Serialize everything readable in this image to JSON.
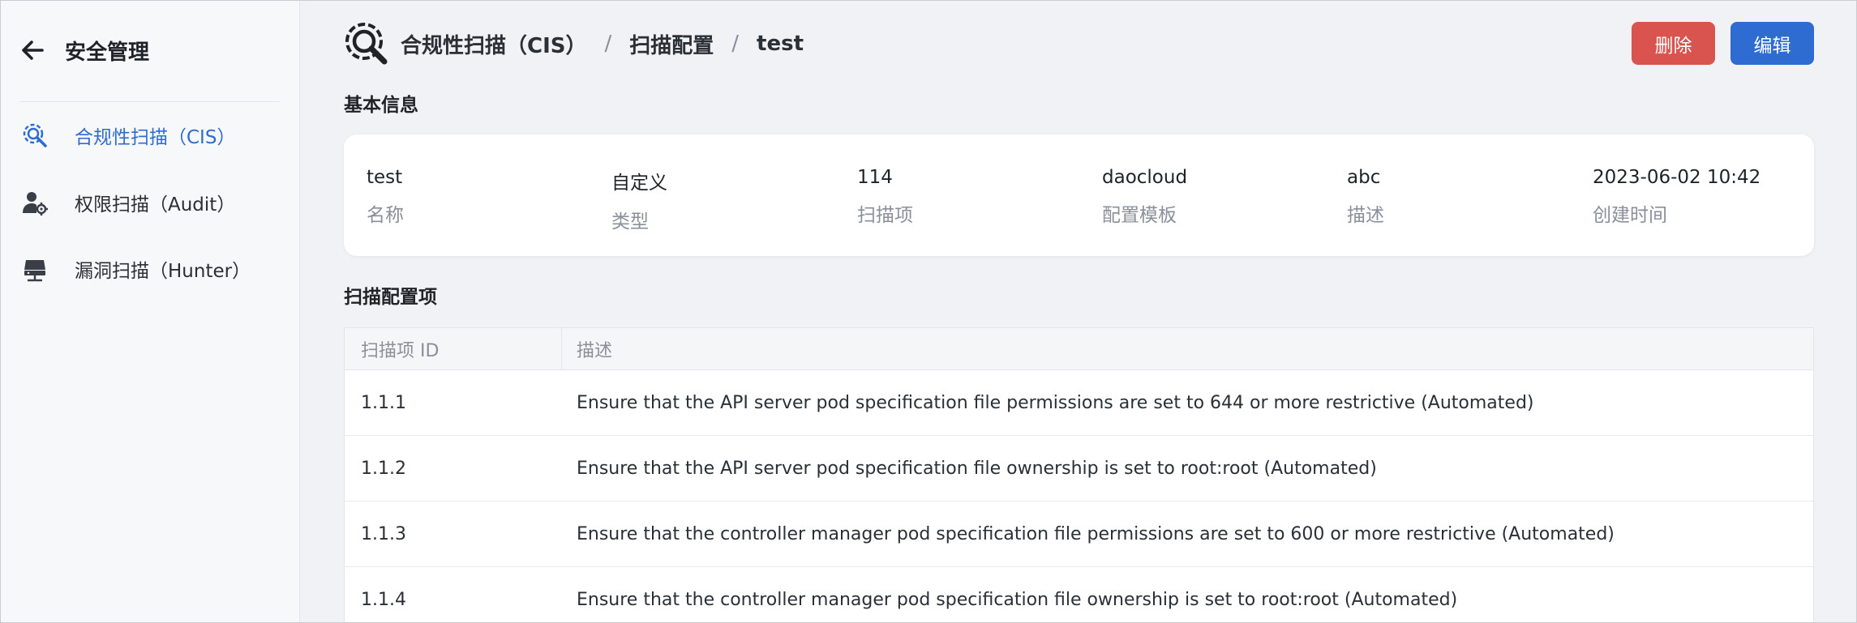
{
  "sidebar": {
    "title": "安全管理",
    "items": [
      {
        "label": "合规性扫描（CIS）",
        "icon": "compliance-scan-icon",
        "active": true
      },
      {
        "label": "权限扫描（Audit）",
        "icon": "permission-scan-icon",
        "active": false
      },
      {
        "label": "漏洞扫描（Hunter）",
        "icon": "vulnerability-scan-icon",
        "active": false
      }
    ]
  },
  "header": {
    "breadcrumb": [
      "合规性扫描（CIS）",
      "扫描配置",
      "test"
    ],
    "separator": "/",
    "delete_label": "删除",
    "edit_label": "编辑"
  },
  "basic_info": {
    "title": "基本信息",
    "fields": [
      {
        "value": "test",
        "label": "名称"
      },
      {
        "value": "自定义",
        "label": "类型"
      },
      {
        "value": "114",
        "label": "扫描项"
      },
      {
        "value": "daocloud",
        "label": "配置模板"
      },
      {
        "value": "abc",
        "label": "描述"
      },
      {
        "value": "2023-06-02 10:42",
        "label": "创建时间"
      }
    ]
  },
  "scan_items": {
    "title": "扫描配置项",
    "columns": [
      "扫描项 ID",
      "描述"
    ],
    "rows": [
      {
        "id": "1.1.1",
        "desc": "Ensure that the API server pod specification file permissions are set to 644 or more restrictive (Automated)"
      },
      {
        "id": "1.1.2",
        "desc": "Ensure that the API server pod specification file ownership is set to root:root (Automated)"
      },
      {
        "id": "1.1.3",
        "desc": "Ensure that the controller manager pod specification file permissions are set to 600 or more restrictive (Automated)"
      },
      {
        "id": "1.1.4",
        "desc": "Ensure that the controller manager pod specification file ownership is set to root:root (Automated)"
      }
    ]
  },
  "colors": {
    "accent": "#2f6cd1",
    "danger": "#d9534f",
    "background": "#f1f2f6"
  }
}
